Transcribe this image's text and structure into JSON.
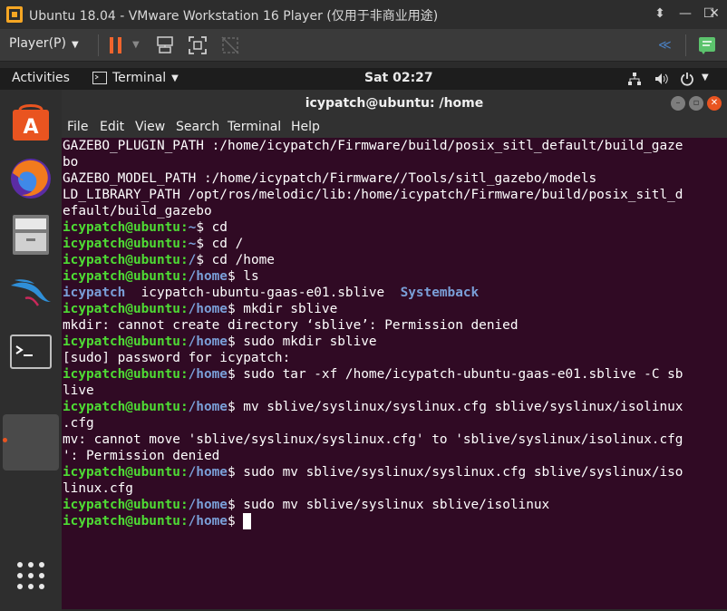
{
  "vm": {
    "title": "Ubuntu 18.04 - VMware Workstation 16 Player (仅用于非商业用途)",
    "player_menu": "Player(P)"
  },
  "topbar": {
    "activities": "Activities",
    "app_menu": "Terminal",
    "clock": "Sat 02:27"
  },
  "terminal": {
    "title": "icypatch@ubuntu: /home",
    "menu": [
      "File",
      "Edit",
      "View",
      "Search",
      "Terminal",
      "Help"
    ],
    "lines": [
      {
        "text": "GAZEBO_PLUGIN_PATH :/home/icypatch/Firmware/build/posix_sitl_default/build_gaze"
      },
      {
        "text": "bo"
      },
      {
        "text": "GAZEBO_MODEL_PATH :/home/icypatch/Firmware//Tools/sitl_gazebo/models"
      },
      {
        "text": "LD_LIBRARY_PATH /opt/ros/melodic/lib:/home/icypatch/Firmware/build/posix_sitl_d"
      },
      {
        "text": "efault/build_gazebo"
      },
      {
        "user": "icypatch@ubuntu",
        "path": "~",
        "cmd": "$ cd"
      },
      {
        "user": "icypatch@ubuntu",
        "path": "~",
        "cmd": "$ cd /"
      },
      {
        "user": "icypatch@ubuntu",
        "path": "/",
        "cmd": "$ cd /home"
      },
      {
        "user": "icypatch@ubuntu",
        "path": "/home",
        "cmd": "$ ls"
      },
      {
        "ls": [
          "icypatch",
          "  icypatch-ubuntu-gaas-e01.sblive  ",
          "Systemback"
        ]
      },
      {
        "user": "icypatch@ubuntu",
        "path": "/home",
        "cmd": "$ mkdir sblive"
      },
      {
        "text": "mkdir: cannot create directory ‘sblive’: Permission denied"
      },
      {
        "user": "icypatch@ubuntu",
        "path": "/home",
        "cmd": "$ sudo mkdir sblive"
      },
      {
        "text": "[sudo] password for icypatch:"
      },
      {
        "user": "icypatch@ubuntu",
        "path": "/home",
        "cmd": "$ sudo tar -xf /home/icypatch-ubuntu-gaas-e01.sblive -C sb"
      },
      {
        "text": "live"
      },
      {
        "user": "icypatch@ubuntu",
        "path": "/home",
        "cmd": "$ mv sblive/syslinux/syslinux.cfg sblive/syslinux/isolinux"
      },
      {
        "text": ".cfg"
      },
      {
        "text": "mv: cannot move 'sblive/syslinux/syslinux.cfg' to 'sblive/syslinux/isolinux.cfg"
      },
      {
        "text": "': Permission denied"
      },
      {
        "user": "icypatch@ubuntu",
        "path": "/home",
        "cmd": "$ sudo mv sblive/syslinux/syslinux.cfg sblive/syslinux/iso"
      },
      {
        "text": "linux.cfg"
      },
      {
        "user": "icypatch@ubuntu",
        "path": "/home",
        "cmd": "$ sudo mv sblive/syslinux sblive/isolinux"
      },
      {
        "user": "icypatch@ubuntu",
        "path": "/home",
        "cmd": "$ ",
        "cursor": true
      }
    ]
  },
  "dock": {
    "items": [
      "software-center-icon",
      "firefox-icon",
      "files-icon",
      "kali-dragon-icon",
      "terminal-icon",
      "show-apps-icon"
    ]
  },
  "colors": {
    "terminal_bg": "#300a24",
    "prompt_user": "#4edc34",
    "prompt_path": "#7a9fd8",
    "ubuntu_orange": "#e95420"
  }
}
